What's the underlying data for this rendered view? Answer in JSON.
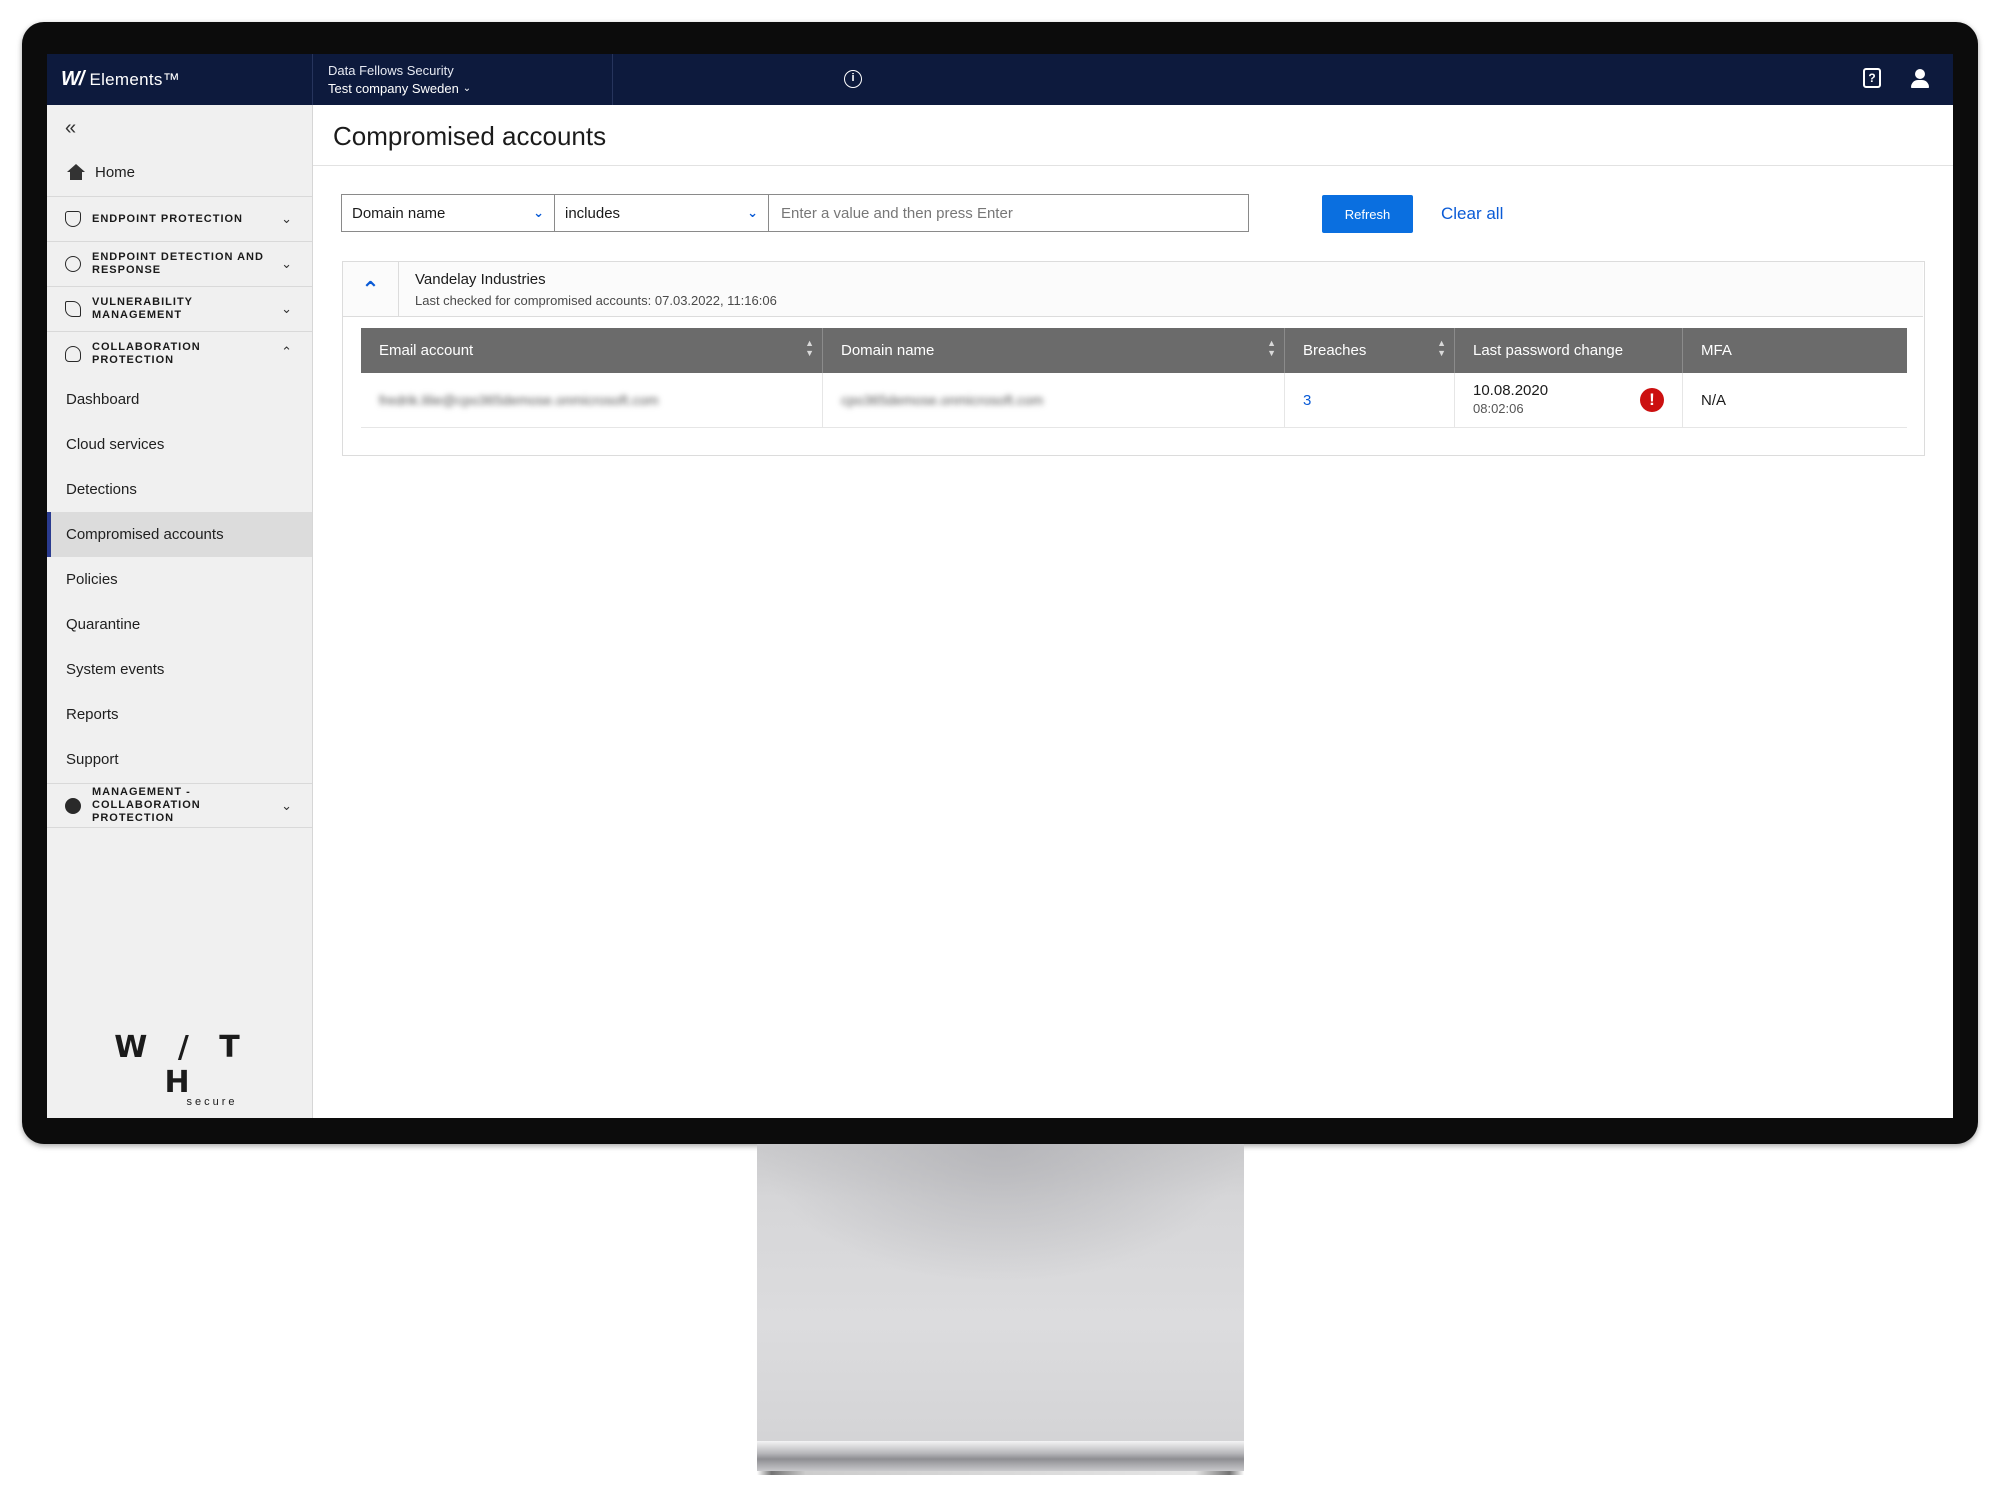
{
  "topbar": {
    "brand_logo": "W/",
    "brand_name": "Elements™",
    "org_name": "Data Fellows Security",
    "company_name": "Test company Sweden",
    "icons": {
      "info": "info-icon",
      "help": "help-book-icon",
      "user": "user-icon"
    }
  },
  "sidebar": {
    "collapse_icon": "double-chevron-left-icon",
    "home_label": "Home",
    "sections": [
      {
        "label": "ENDPOINT PROTECTION",
        "icon": "shield-icon",
        "expanded": false
      },
      {
        "label": "ENDPOINT DETECTION AND RESPONSE",
        "icon": "radar-icon",
        "expanded": false
      },
      {
        "label": "VULNERABILITY MANAGEMENT",
        "icon": "tag-icon",
        "expanded": false
      },
      {
        "label": "COLLABORATION PROTECTION",
        "icon": "cloud-icon",
        "expanded": true
      },
      {
        "label": "MANAGEMENT - COLLABORATION PROTECTION",
        "icon": "cloud-gear-icon",
        "expanded": false
      }
    ],
    "items": [
      "Dashboard",
      "Cloud services",
      "Detections",
      "Compromised accounts",
      "Policies",
      "Quarantine",
      "System events",
      "Reports",
      "Support"
    ],
    "active_item": "Compromised accounts",
    "footer_logo": "W / T H",
    "footer_sub": "secure"
  },
  "page": {
    "title": "Compromised accounts"
  },
  "filters": {
    "field": "Domain name",
    "operator": "includes",
    "value_placeholder": "Enter a value and then press Enter",
    "refresh_label": "Refresh",
    "clear_label": "Clear all"
  },
  "group": {
    "name": "Vandelay Industries",
    "last_checked": "Last checked for compromised accounts: 07.03.2022, 11:16:06"
  },
  "table": {
    "columns": [
      "Email account",
      "Domain name",
      "Breaches",
      "Last password change",
      "MFA"
    ],
    "rows": [
      {
        "email": "fredrik.lilie@cpo365demose.onmicrosoft.com",
        "domain": "cpo365demose.onmicrosoft.com",
        "breaches": "3",
        "pwd_date": "10.08.2020",
        "pwd_time": "08:02:06",
        "mfa": "N/A"
      }
    ]
  },
  "colors": {
    "topbar_bg": "#0d1a3d",
    "accent_blue": "#0a6fe0",
    "alert_red": "#cc1010",
    "active_marker": "#2a3b8f"
  }
}
